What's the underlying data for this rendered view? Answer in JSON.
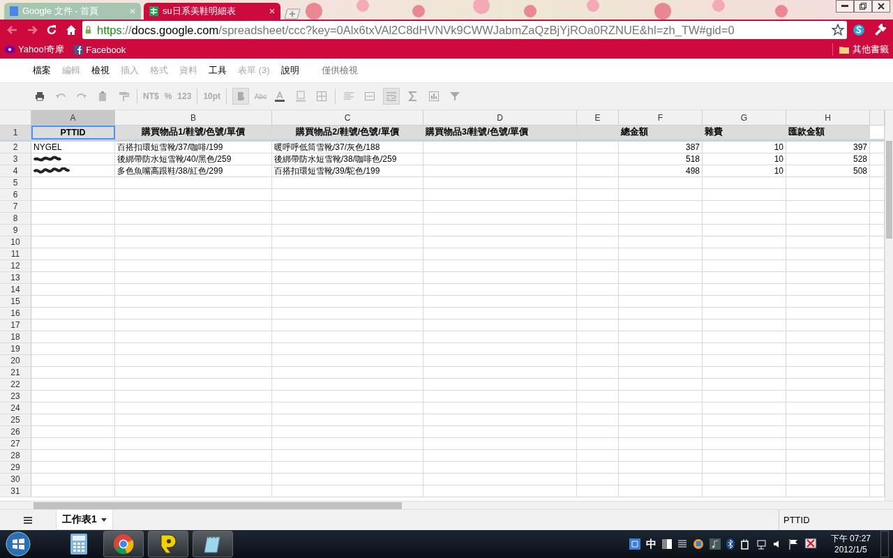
{
  "browser_tabs": [
    {
      "title": "Google 文件 - 首頁",
      "kind": "docs",
      "selected": false
    },
    {
      "title": "su日系美鞋明細表",
      "kind": "sheet",
      "selected": true
    }
  ],
  "address": {
    "scheme": "https",
    "separator": "://",
    "host": "docs.google.com",
    "path": "/spreadsheet/ccc?key=0Alx6txVAl2C8dHVNVk9CWWJabmZaQzBjYjROa0RZNUE&hl=zh_TW#gid=0"
  },
  "bookmarks": [
    {
      "label": "Yahoo!奇摩",
      "kind": "yahoo"
    },
    {
      "label": "Facebook",
      "kind": "facebook"
    }
  ],
  "other_bookmarks": "其他書籤",
  "menu": [
    {
      "label": "檔案",
      "disabled": false
    },
    {
      "label": "編輯",
      "disabled": true
    },
    {
      "label": "檢視",
      "disabled": false
    },
    {
      "label": "插入",
      "disabled": true
    },
    {
      "label": "格式",
      "disabled": true
    },
    {
      "label": "資料",
      "disabled": true
    },
    {
      "label": "工具",
      "disabled": false
    },
    {
      "label": "表單 (3)",
      "disabled": true
    },
    {
      "label": "說明",
      "disabled": false
    }
  ],
  "view_only": "僅供檢視",
  "toolbar": {
    "currency": "NT$",
    "percent": "%",
    "number_format": "123",
    "font_size": "10pt",
    "strikethrough": "Abc"
  },
  "columns": [
    {
      "letter": "A",
      "selected": true
    },
    {
      "letter": "B",
      "selected": false
    },
    {
      "letter": "C",
      "selected": false
    },
    {
      "letter": "D",
      "selected": false
    },
    {
      "letter": "E",
      "selected": false
    },
    {
      "letter": "F",
      "selected": false
    },
    {
      "letter": "G",
      "selected": false
    },
    {
      "letter": "H",
      "selected": false
    }
  ],
  "header_row": {
    "number": "1",
    "cells": [
      {
        "kind": "text",
        "text": "PTTID",
        "centered": true,
        "selected": true
      },
      {
        "kind": "text",
        "text": "購買物品1/鞋號/色號/單價",
        "centered": true,
        "selected": false
      },
      {
        "kind": "text",
        "text": "購買物品2/鞋號/色號/單價",
        "centered": true,
        "selected": false
      },
      {
        "kind": "text",
        "text": "購買物品3/鞋號/色號/單價",
        "centered": false,
        "selected": false
      },
      {
        "kind": "empty"
      },
      {
        "kind": "text",
        "text": "總金額",
        "centered": false,
        "selected": false
      },
      {
        "kind": "text",
        "text": "雜費",
        "centered": false,
        "selected": false
      },
      {
        "kind": "text",
        "text": "匯款金額",
        "centered": false,
        "selected": false
      }
    ]
  },
  "rows": [
    {
      "number": "2",
      "cells": [
        {
          "kind": "text",
          "text": "NYGEL"
        },
        {
          "kind": "text",
          "text": "百搭扣環短雪靴/37/咖啡/199"
        },
        {
          "kind": "text",
          "text": "暖呼呼低筒雪靴/37/灰色/188"
        },
        {
          "kind": "empty"
        },
        {
          "kind": "empty"
        },
        {
          "kind": "number",
          "text": "387"
        },
        {
          "kind": "number",
          "text": "10"
        },
        {
          "kind": "number",
          "text": "397"
        }
      ]
    },
    {
      "number": "3",
      "cells": [
        {
          "kind": "redacted"
        },
        {
          "kind": "text",
          "text": "後綁帶防水短雪靴/40/黑色/259"
        },
        {
          "kind": "text",
          "text": "後綁帶防水短雪靴/38/咖啡色/259"
        },
        {
          "kind": "empty"
        },
        {
          "kind": "empty"
        },
        {
          "kind": "number",
          "text": "518"
        },
        {
          "kind": "number",
          "text": "10"
        },
        {
          "kind": "number",
          "text": "528"
        }
      ]
    },
    {
      "number": "4",
      "cells": [
        {
          "kind": "redacted"
        },
        {
          "kind": "text",
          "text": "多色魚嘴高跟鞋/38/紅色/299"
        },
        {
          "kind": "text",
          "text": "百搭扣環短雪靴/39/駝色/199"
        },
        {
          "kind": "empty"
        },
        {
          "kind": "empty"
        },
        {
          "kind": "number",
          "text": "498"
        },
        {
          "kind": "number",
          "text": "10"
        },
        {
          "kind": "number",
          "text": "508"
        }
      ]
    },
    {
      "number": "5",
      "cells": []
    },
    {
      "number": "6",
      "cells": []
    },
    {
      "number": "7",
      "cells": []
    },
    {
      "number": "8",
      "cells": []
    },
    {
      "number": "9",
      "cells": []
    },
    {
      "number": "10",
      "cells": []
    },
    {
      "number": "11",
      "cells": []
    },
    {
      "number": "12",
      "cells": []
    },
    {
      "number": "13",
      "cells": []
    },
    {
      "number": "14",
      "cells": []
    },
    {
      "number": "15",
      "cells": []
    },
    {
      "number": "16",
      "cells": []
    },
    {
      "number": "17",
      "cells": []
    },
    {
      "number": "18",
      "cells": []
    },
    {
      "number": "19",
      "cells": []
    },
    {
      "number": "20",
      "cells": []
    },
    {
      "number": "21",
      "cells": []
    },
    {
      "number": "22",
      "cells": []
    },
    {
      "number": "23",
      "cells": []
    },
    {
      "number": "24",
      "cells": []
    },
    {
      "number": "25",
      "cells": []
    },
    {
      "number": "26",
      "cells": []
    },
    {
      "number": "27",
      "cells": []
    },
    {
      "number": "28",
      "cells": []
    },
    {
      "number": "29",
      "cells": []
    },
    {
      "number": "30",
      "cells": []
    },
    {
      "number": "31",
      "cells": []
    }
  ],
  "sheet_tabs": [
    {
      "label": "工作表1",
      "selected": true
    }
  ],
  "status": "PTTID",
  "taskbar": {
    "apps": [
      {
        "kind": "calculator",
        "active": false
      },
      {
        "kind": "chrome",
        "active": true
      },
      {
        "kind": "p_logo",
        "active": true
      },
      {
        "kind": "notepad",
        "active": true
      }
    ],
    "ime": "中",
    "time": "下午 07:27",
    "date": "2012/1/5"
  }
}
